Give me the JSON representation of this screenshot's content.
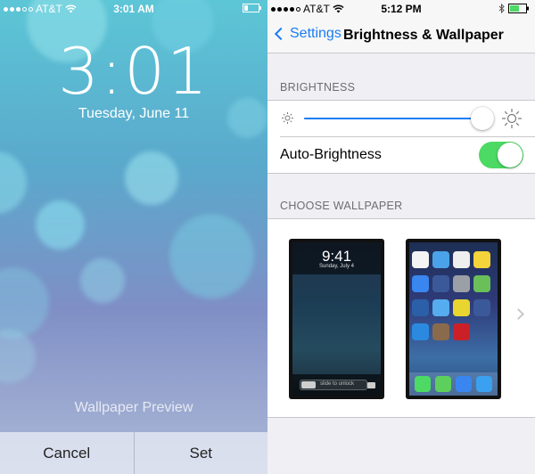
{
  "lock_preview": {
    "status": {
      "carrier": "AT&T",
      "time": "3:01 AM"
    },
    "clock_time": "3:01",
    "date": "Tuesday, June 11",
    "preview_label": "Wallpaper Preview",
    "cancel_label": "Cancel",
    "set_label": "Set"
  },
  "settings": {
    "status": {
      "carrier": "AT&T",
      "time": "5:12 PM"
    },
    "nav": {
      "back_label": "Settings",
      "title": "Brightness & Wallpaper"
    },
    "brightness": {
      "header": "BRIGHTNESS",
      "slider_level": 0.94,
      "auto_label": "Auto-Brightness",
      "auto_enabled": true
    },
    "wallpaper": {
      "header": "CHOOSE WALLPAPER",
      "lock_thumb": {
        "time": "9:41",
        "date": "Sunday, July 4",
        "unlock_text": "slide to unlock"
      }
    }
  },
  "colors": {
    "accent": "#1a7cf4",
    "toggle_on": "#4cd964",
    "grouped_bg": "#efeff4"
  },
  "icons": [
    "signal-dots-icon",
    "wifi-icon",
    "battery-icon",
    "bluetooth-icon",
    "back-chevron-icon",
    "sun-small-icon",
    "sun-large-icon",
    "chevron-right-icon",
    "camera-icon"
  ]
}
